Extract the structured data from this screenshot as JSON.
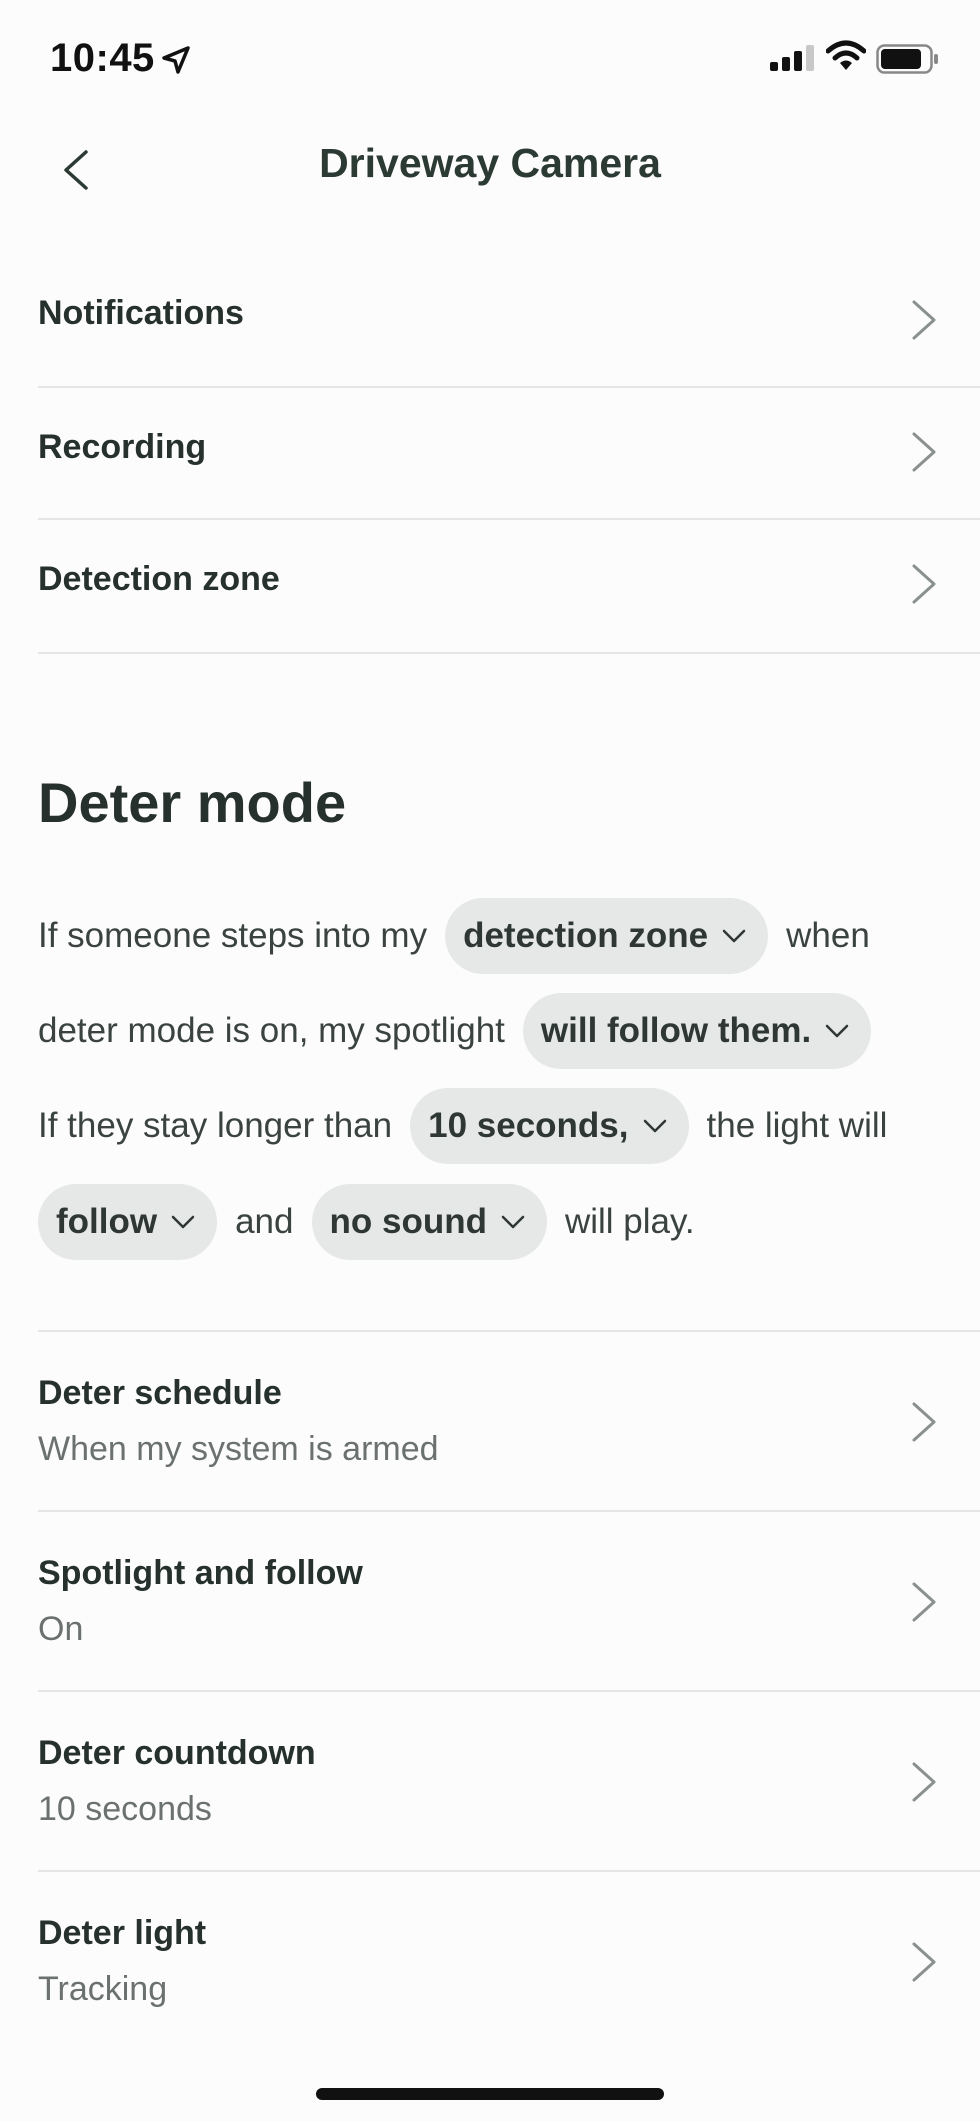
{
  "status_bar": {
    "time": "10:45"
  },
  "nav": {
    "title": "Driveway Camera"
  },
  "menu": [
    {
      "label": "Notifications"
    },
    {
      "label": "Recording"
    },
    {
      "label": "Detection zone"
    }
  ],
  "deter": {
    "title": "Deter mode",
    "sentence": {
      "t1": "If someone steps into my",
      "p1": "detection zone",
      "t2": "when",
      "t3": "deter mode is on, my spotlight",
      "p2": "will follow them.",
      "t4": "If they stay longer than",
      "p3": "10 seconds,",
      "t5": "the light will",
      "p4": "follow",
      "t6": "and",
      "p5": "no sound",
      "t7": "will play."
    }
  },
  "settings": [
    {
      "label": "Deter schedule",
      "value": "When my system is armed"
    },
    {
      "label": "Spotlight and follow",
      "value": "On"
    },
    {
      "label": "Deter countdown",
      "value": "10 seconds"
    },
    {
      "label": "Deter light",
      "value": "Tracking"
    }
  ]
}
